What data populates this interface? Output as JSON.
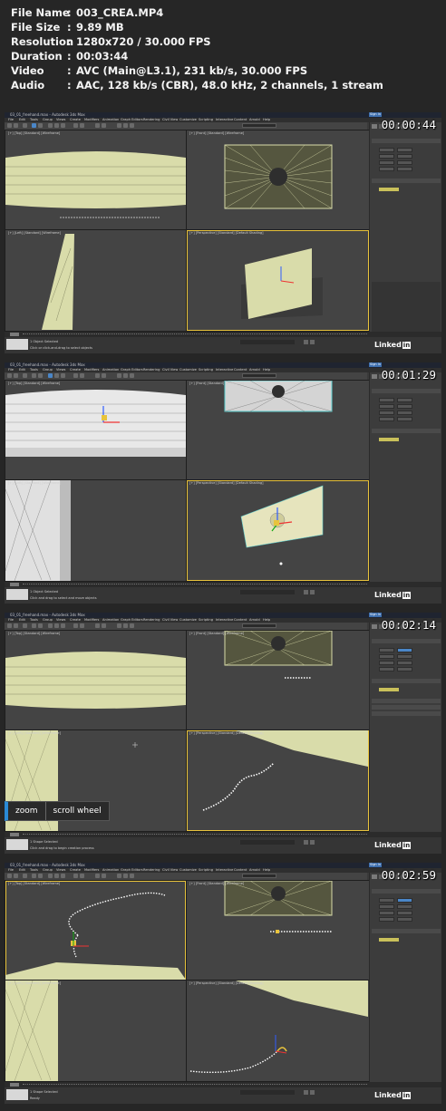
{
  "info": {
    "rows": [
      {
        "label": "File Name",
        "value": "003_CREA.MP4"
      },
      {
        "label": "File Size",
        "value": "9.89 MB"
      },
      {
        "label": "Resolution",
        "value": "1280x720 / 30.000 FPS"
      },
      {
        "label": "Duration",
        "value": "00:03:44"
      },
      {
        "label": "Video",
        "value": "AVC (Main@L3.1), 231 kb/s, 30.000 FPS"
      },
      {
        "label": "Audio",
        "value": "AAC, 128 kb/s (CBR), 48.0 kHz, 2 channels, 1 stream"
      }
    ]
  },
  "app": {
    "window_title": "03_01_freehand.max - Autodesk 3ds Max",
    "sign_in": "Sign In",
    "menu": [
      "File",
      "Edit",
      "Tools",
      "Group",
      "Views",
      "Create",
      "Modifiers",
      "Animation",
      "Graph Editors",
      "Rendering",
      "Civil View",
      "Customize",
      "Scripting",
      "Interactive",
      "Content",
      "Arnold",
      "Help"
    ],
    "viewport_labels": {
      "top": "[+] [Top] [Standard] [Wireframe]",
      "front": "[+] [Front] [Standard] [Wireframe]",
      "left": "[+] [Left] [Standard] [Wireframe]",
      "persp": "[+] [Perspective] [Standard] [Default Shading]"
    },
    "linkedin": "Linked",
    "linkedin_in": "in",
    "colors": {
      "accent": "#4a86c8",
      "active_viewport": "#e8c33c",
      "mesh": "#d9dcaa",
      "spline": "#ffffff"
    }
  },
  "frames": [
    {
      "timestamp": "00:00:44",
      "status1": "1 Object Selected",
      "status2": "Click or click-and-drag to select objects"
    },
    {
      "timestamp": "00:01:29",
      "status1": "1 Object Selected",
      "status2": "Click and drag to select and move objects"
    },
    {
      "timestamp": "00:02:14",
      "status1": "1 Shape Selected",
      "status2": "Click and drag to begin creation process",
      "overlay": {
        "key": "zoom",
        "action": "scroll wheel"
      }
    },
    {
      "timestamp": "00:02:59",
      "status1": "1 Shape Selected",
      "status2": "Ready"
    }
  ]
}
